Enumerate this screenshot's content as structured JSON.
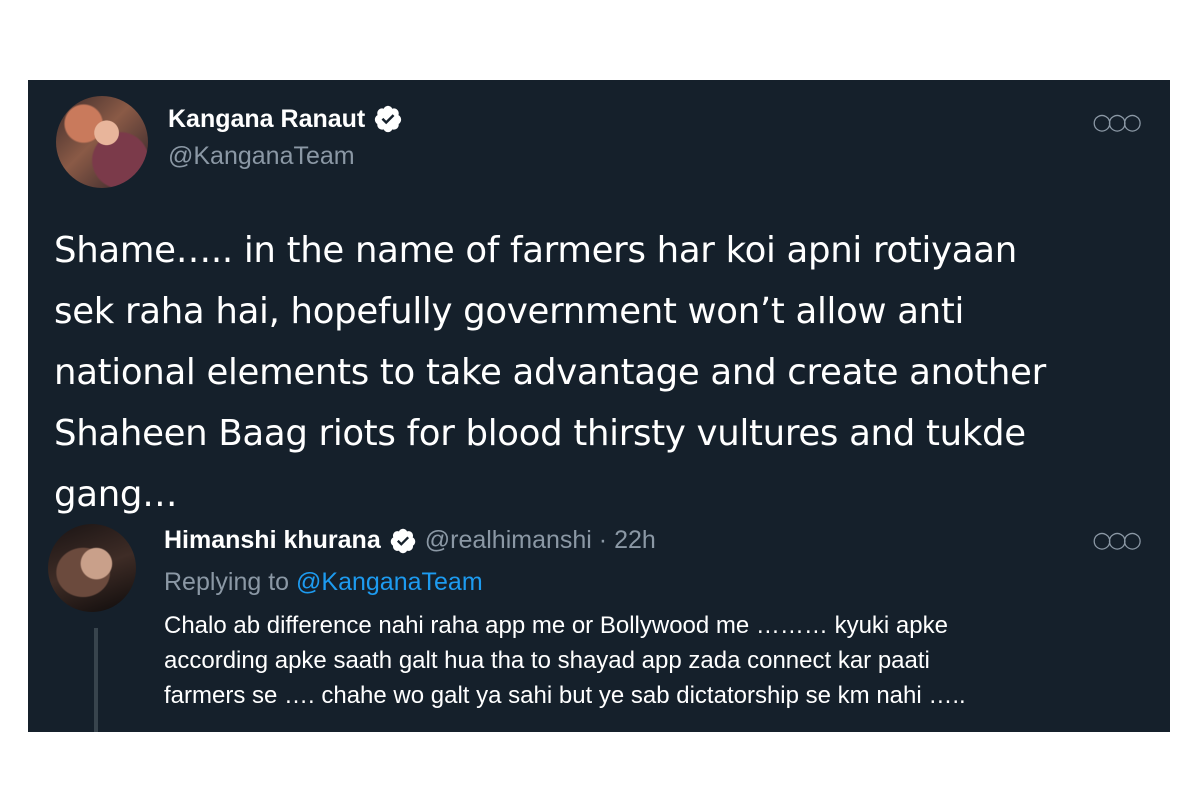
{
  "tweet": {
    "author_name": "Kangana Ranaut",
    "author_handle": "@KanganaTeam",
    "more_icon": "more-horizontal-icon",
    "verified_icon": "verified-badge-icon",
    "text": "Shame….. in the name of farmers har koi apni rotiyaan\nsek raha hai, hopefully government won’t allow anti\nnational elements to take advantage and create another\nShaheen Baag riots for blood thirsty vultures and tukde\ngang…"
  },
  "reply": {
    "author_name": "Himanshi khurana",
    "author_handle": "@realhimanshi · 22h",
    "replying_prefix": "Replying to",
    "replying_to": "@KanganaTeam",
    "text": "Chalo ab difference nahi raha app me or Bollywood me ……… kyuki apke\naccording apke saath galt hua tha to shayad app zada connect kar paati\nfarmers se …. chahe wo galt ya sahi but ye sab dictatorship se km nahi ….."
  },
  "colors": {
    "background": "#15202b",
    "accent": "#1d9bf0",
    "muted": "#8b98a5"
  }
}
